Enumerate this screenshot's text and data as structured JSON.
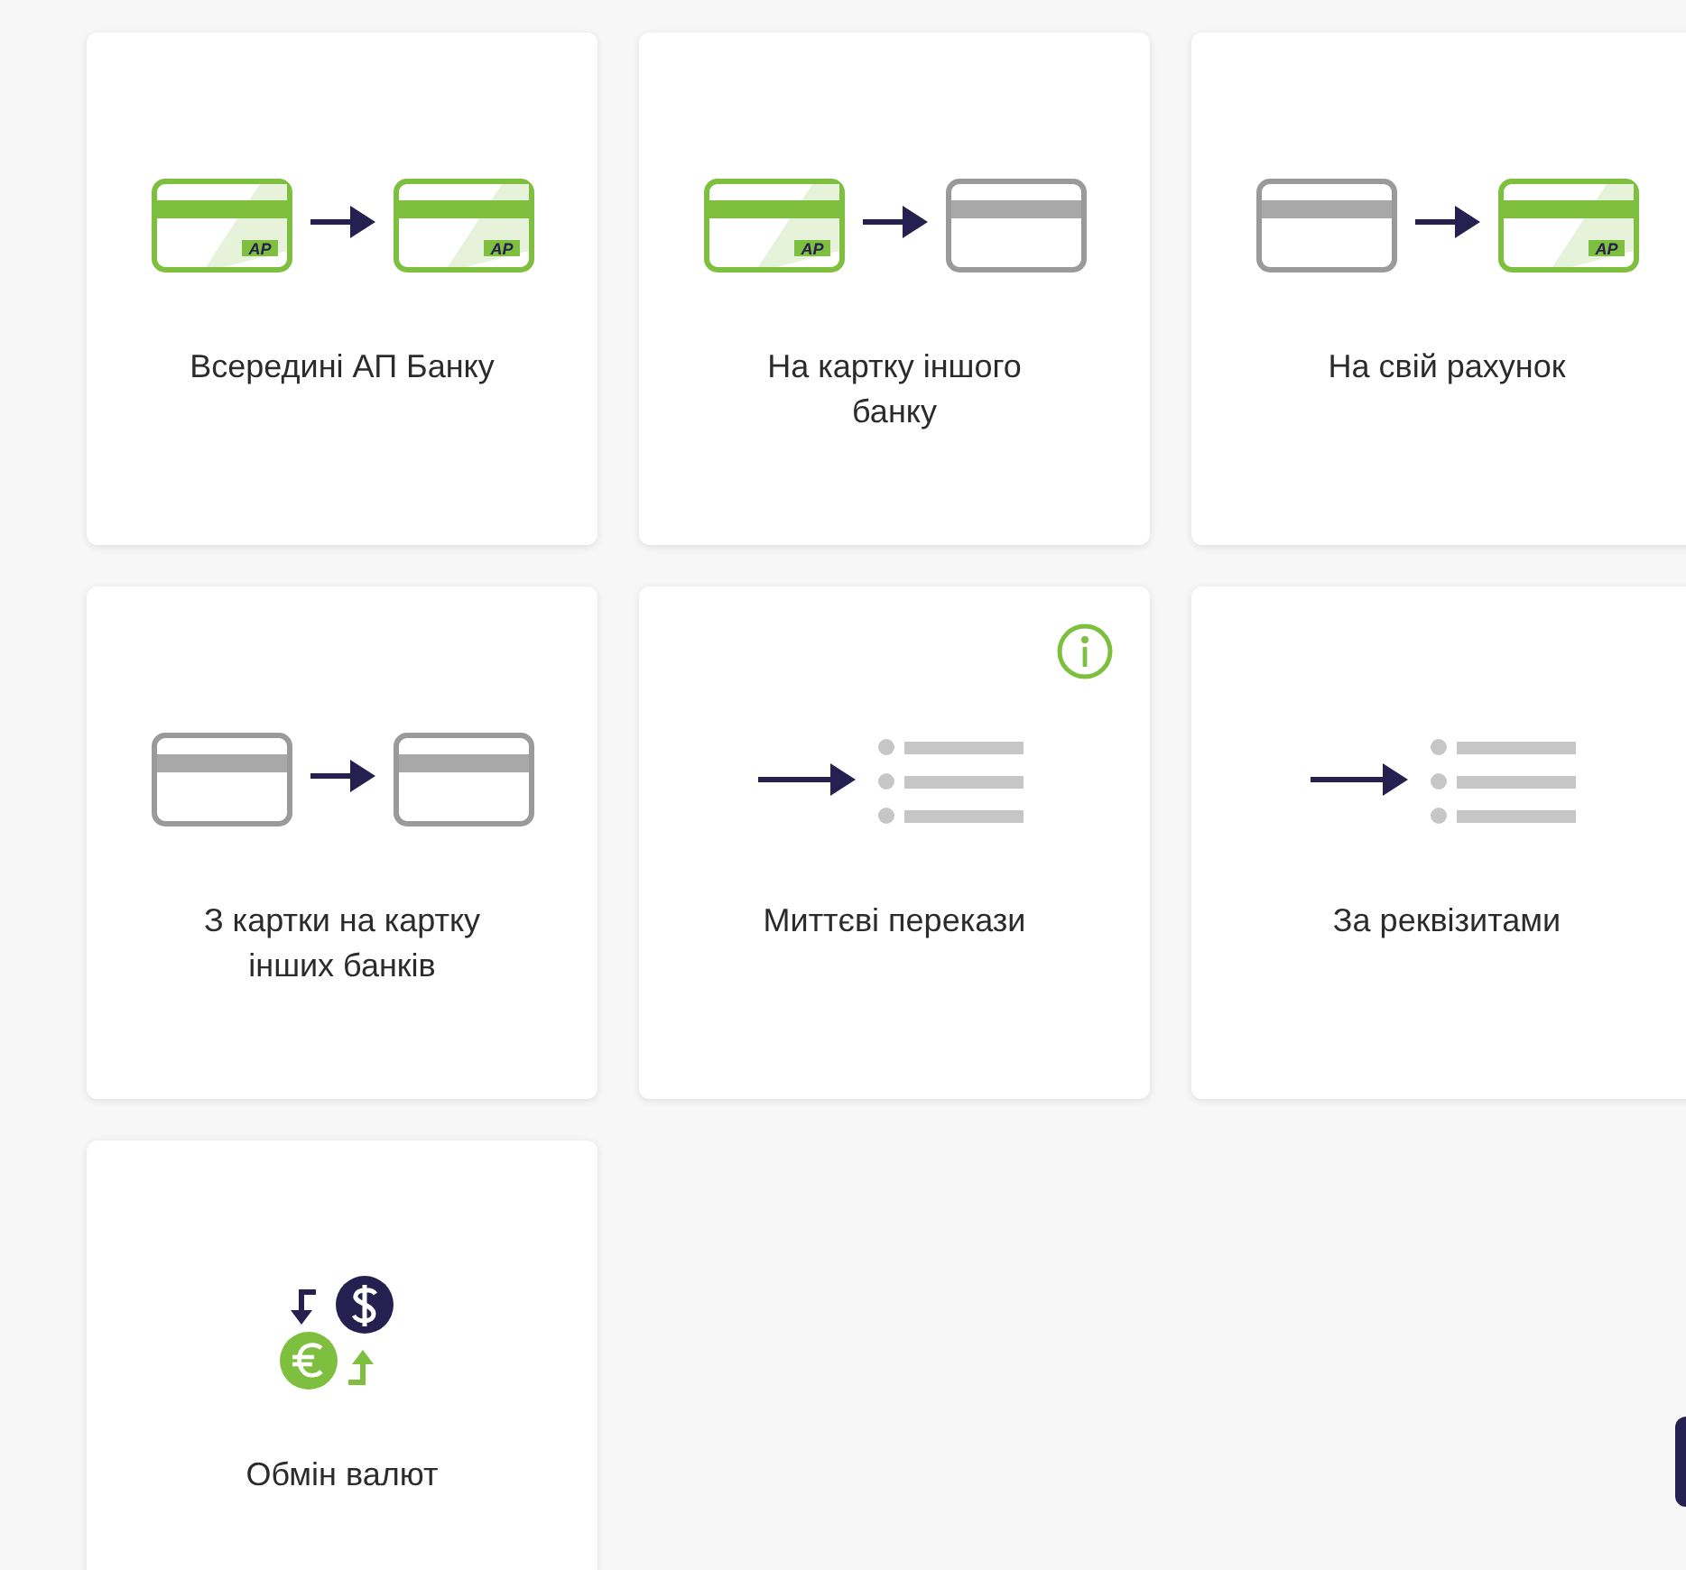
{
  "tiles": [
    {
      "label": "Всередині АП Банку",
      "kind": "cards",
      "cards": [
        {
          "kind": "bank",
          "logo": "AP"
        },
        {
          "kind": "bank",
          "logo": "AP"
        }
      ],
      "info": false
    },
    {
      "label": "На картку іншого банку",
      "kind": "cards",
      "cards": [
        {
          "kind": "bank",
          "logo": "AP"
        },
        {
          "kind": "other"
        }
      ],
      "info": false
    },
    {
      "label": "На свій рахунок",
      "kind": "cards",
      "cards": [
        {
          "kind": "other"
        },
        {
          "kind": "bank",
          "logo": "AP"
        }
      ],
      "info": false
    },
    {
      "label": "З картки на картку інших банків",
      "kind": "cards",
      "cards": [
        {
          "kind": "other"
        },
        {
          "kind": "other"
        }
      ],
      "info": false
    },
    {
      "label": "Миттєві перекази",
      "kind": "list",
      "info": true
    },
    {
      "label": "За реквізитами",
      "kind": "list",
      "info": false
    },
    {
      "label": "Обмін валют",
      "kind": "exchange",
      "info": false
    }
  ]
}
